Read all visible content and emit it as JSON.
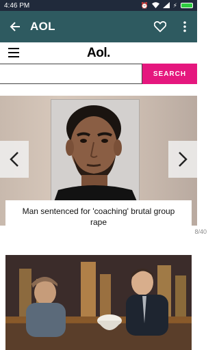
{
  "status_bar": {
    "time": "4:46 PM"
  },
  "app_bar": {
    "title": "AOL",
    "back_icon": "arrow-left-icon",
    "favorite_icon": "heart-outline-icon",
    "more_icon": "more-vert-icon"
  },
  "site": {
    "logo": "Aol.",
    "menu_icon": "hamburger-icon"
  },
  "search": {
    "placeholder": "",
    "value": "",
    "button_label": "SEARCH",
    "button_color": "#e5177e"
  },
  "slideshow": {
    "caption": "Man sentenced for 'coaching' brutal group rape",
    "counter": "8/40",
    "prev_icon": "chevron-left-icon",
    "next_icon": "chevron-right-icon"
  },
  "colors": {
    "status_bar": "#202a3b",
    "app_bar": "#2e5a60",
    "accent": "#e5177e"
  }
}
